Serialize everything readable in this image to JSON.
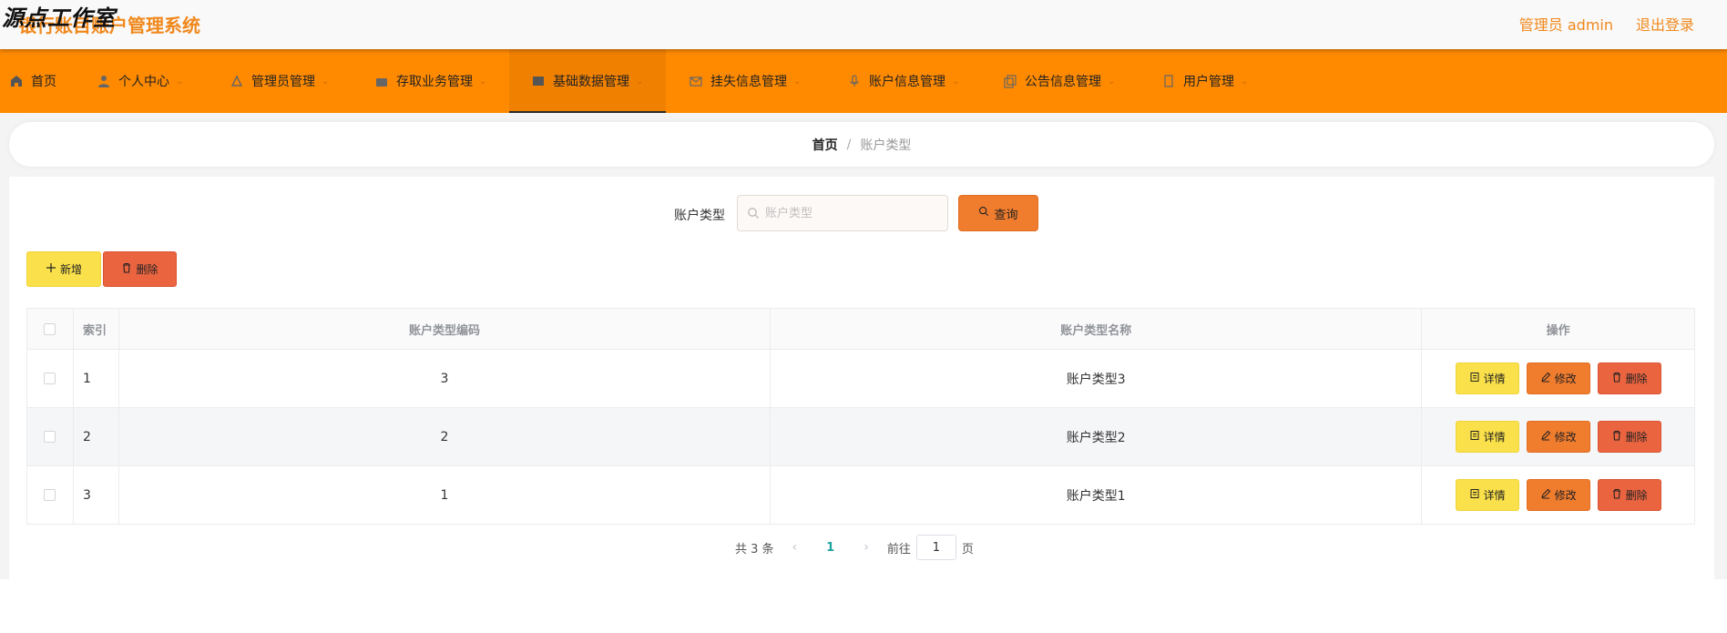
{
  "watermark": "源点工作室",
  "header": {
    "title": "银行账目账户管理系统",
    "user": "管理员 admin",
    "logout": "退出登录"
  },
  "nav": {
    "items": [
      {
        "label": "首页",
        "icon": "home-icon"
      },
      {
        "label": "个人中心",
        "icon": "user-icon"
      },
      {
        "label": "管理员管理",
        "icon": "admin-icon"
      },
      {
        "label": "存取业务管理",
        "icon": "wallet-icon"
      },
      {
        "label": "基础数据管理",
        "icon": "data-icon"
      },
      {
        "label": "挂失信息管理",
        "icon": "mail-icon"
      },
      {
        "label": "账户信息管理",
        "icon": "mic-icon"
      },
      {
        "label": "公告信息管理",
        "icon": "copy-icon"
      },
      {
        "label": "用户管理",
        "icon": "doc-icon"
      }
    ],
    "active_index": 4
  },
  "breadcrumb": {
    "home": "首页",
    "separator": "/",
    "current": "账户类型"
  },
  "search": {
    "label": "账户类型",
    "placeholder": "账户类型",
    "value": "",
    "button": "查询"
  },
  "actions": {
    "add": "新增",
    "delete": "删除"
  },
  "table": {
    "columns": [
      "索引",
      "账户类型编码",
      "账户类型名称",
      "操作"
    ],
    "rows": [
      {
        "index": "1",
        "code": "3",
        "name": "账户类型3"
      },
      {
        "index": "2",
        "code": "2",
        "name": "账户类型2"
      },
      {
        "index": "3",
        "code": "1",
        "name": "账户类型1"
      }
    ],
    "row_actions": {
      "detail": "详情",
      "edit": "修改",
      "delete": "删除"
    }
  },
  "pagination": {
    "total": "共 3 条",
    "current_page": "1",
    "goto_label": "前往",
    "goto_value": "1",
    "page_suffix": "页"
  },
  "colors": {
    "nav_bg": "#ff8a00",
    "accent": "#f0881c",
    "yellow_btn": "#fae04a",
    "orange_btn": "#f07c2e",
    "red_btn": "#ea6440",
    "page_active": "#1fa1a1"
  }
}
